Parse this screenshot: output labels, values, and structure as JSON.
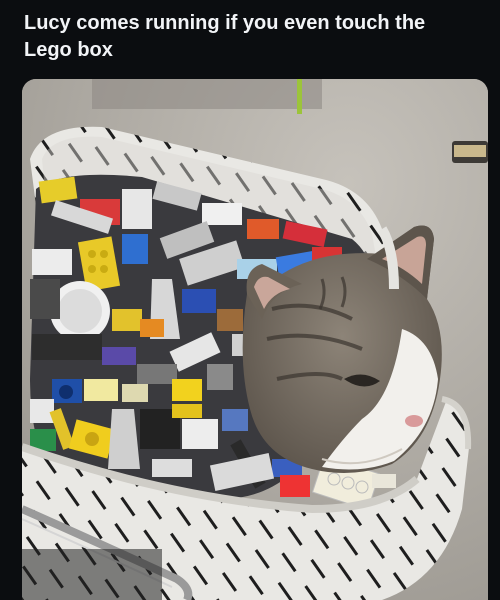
{
  "post": {
    "text": "Lucy comes running if you even touch the Lego box"
  },
  "media": {
    "alt": "",
    "colors": {
      "page_background": "#0b0d10",
      "text": "#f2f4f7",
      "carpet": "#b4afa7",
      "basket_fabric": "#e8e7e3",
      "basket_stripes": "#1c1c1c",
      "cat_fur": "#7a7166",
      "cat_white": "#f3f1ee"
    }
  }
}
